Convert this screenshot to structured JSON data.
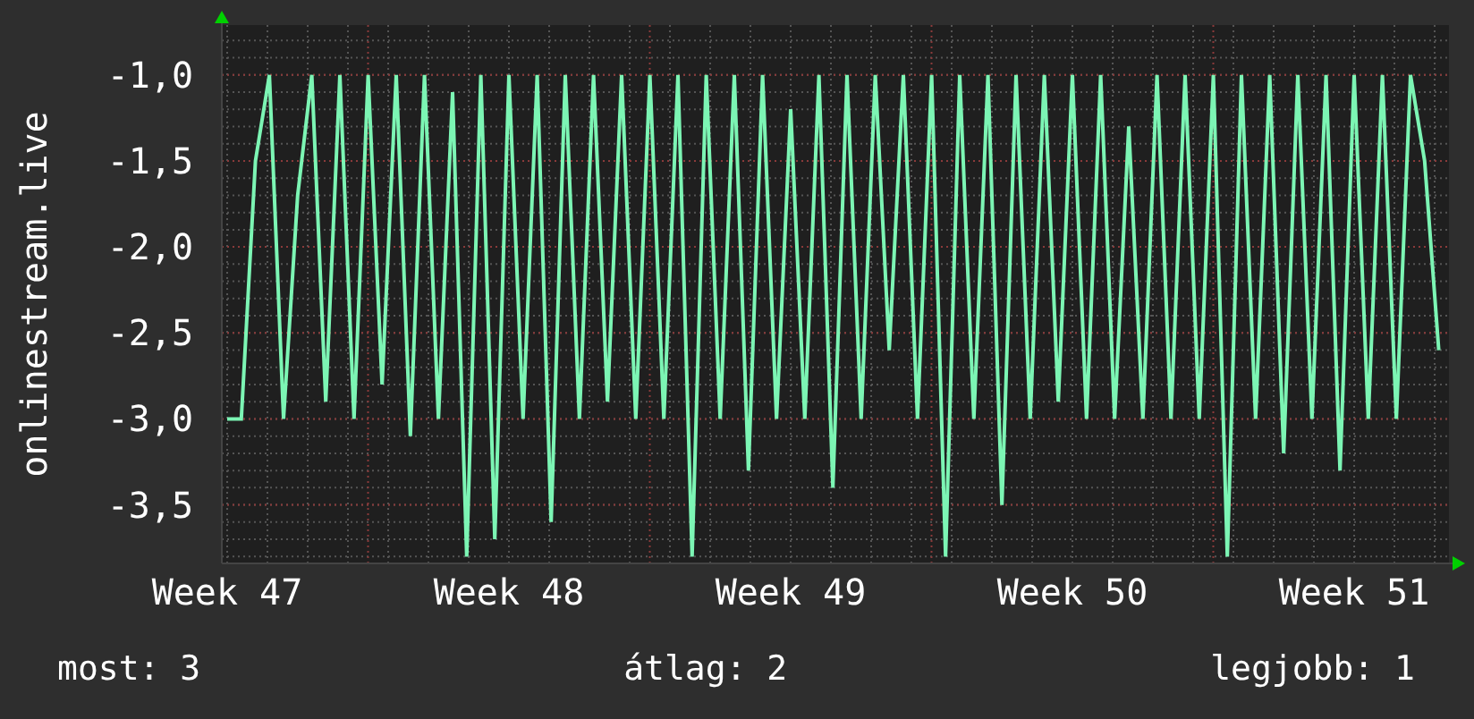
{
  "graph": {
    "chart_data": {
      "type": "line",
      "grid": true,
      "ylabel": "onlinestream.live",
      "ylim": [
        -3.84,
        -0.71
      ],
      "yticks": [
        {
          "value": -1.0,
          "label": "-1,0"
        },
        {
          "value": -1.5,
          "label": "-1,5"
        },
        {
          "value": -2.0,
          "label": "-2,0"
        },
        {
          "value": -2.5,
          "label": "-2,5"
        },
        {
          "value": -3.0,
          "label": "-3,0"
        },
        {
          "value": -3.5,
          "label": "-3,5"
        }
      ],
      "categories": [
        "Week 47",
        null,
        null,
        null,
        null,
        null,
        null,
        null,
        null,
        null,
        null,
        null,
        null,
        null,
        null,
        null,
        null,
        null,
        null,
        null,
        "Week 48",
        null,
        null,
        null,
        null,
        null,
        null,
        null,
        null,
        null,
        null,
        null,
        null,
        null,
        null,
        null,
        null,
        null,
        null,
        null,
        "Week 49",
        null,
        null,
        null,
        null,
        null,
        null,
        null,
        null,
        null,
        null,
        null,
        null,
        null,
        null,
        null,
        null,
        null,
        null,
        null,
        "Week 50",
        null,
        null,
        null,
        null,
        null,
        null,
        null,
        null,
        null,
        null,
        null,
        null,
        null,
        null,
        null,
        null,
        null,
        null,
        null,
        "Week 51",
        null,
        null,
        null,
        null,
        null,
        null
      ],
      "series": [
        {
          "color": "#7cf5b4",
          "values": [
            -3.0,
            -3.0,
            -1.5,
            -1.0,
            -3.0,
            -1.7,
            -1.0,
            -2.9,
            -1.0,
            -3.0,
            -1.0,
            -2.8,
            -1.0,
            -3.1,
            -1.0,
            -3.0,
            -1.1,
            -3.8,
            -1.0,
            -3.7,
            -1.0,
            -3.0,
            -1.0,
            -3.6,
            -1.0,
            -3.0,
            -1.0,
            -2.9,
            -1.0,
            -3.0,
            -1.0,
            -3.0,
            -1.0,
            -3.8,
            -1.0,
            -3.0,
            -1.0,
            -3.3,
            -1.0,
            -3.0,
            -1.2,
            -3.0,
            -1.0,
            -3.4,
            -1.0,
            -3.0,
            -1.0,
            -2.6,
            -1.0,
            -3.0,
            -1.0,
            -3.8,
            -1.0,
            -3.0,
            -1.0,
            -3.5,
            -1.0,
            -3.0,
            -1.0,
            -2.9,
            -1.0,
            -3.0,
            -1.0,
            -3.0,
            -1.3,
            -3.0,
            -1.0,
            -3.0,
            -1.0,
            -3.0,
            -1.0,
            -3.8,
            -1.0,
            -3.0,
            -1.0,
            -3.2,
            -1.0,
            -3.0,
            -1.0,
            -3.3,
            -1.0,
            -3.0,
            -1.0,
            -3.0,
            -1.0,
            -1.5,
            -2.6
          ]
        }
      ]
    }
  },
  "legend": [
    {
      "label": "most: 3"
    },
    {
      "label": "átlag: 2"
    },
    {
      "label": "legjobb: 1"
    }
  ]
}
